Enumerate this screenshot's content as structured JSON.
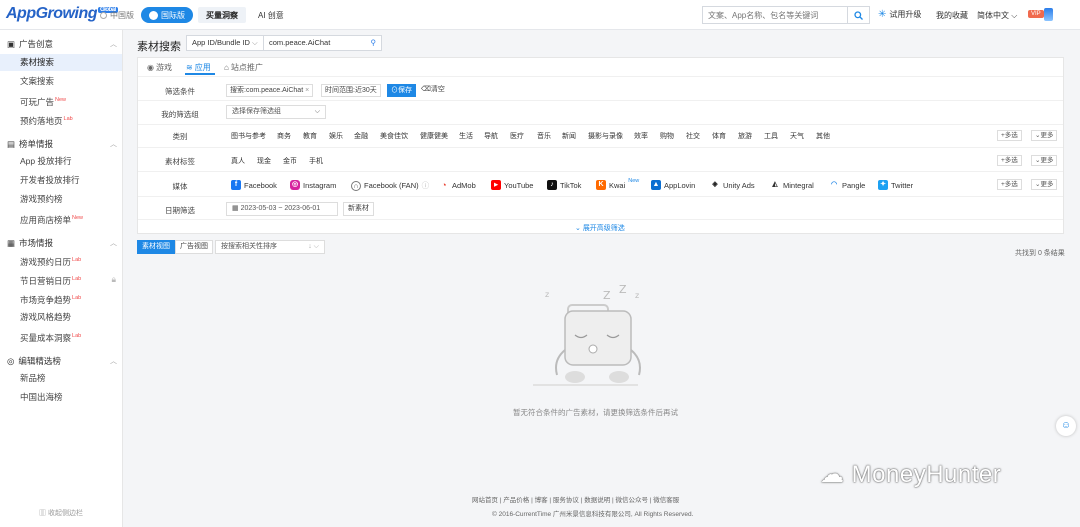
{
  "logo": {
    "text": "AppGrowing",
    "badge": "Global"
  },
  "nav": {
    "cn": "中国版",
    "intl": "国际版",
    "buy": "买量洞察",
    "ai": "AI 创意"
  },
  "search": {
    "placeholder": "文案、App名称、包名等关键词"
  },
  "header": {
    "upgrade": "试用升级",
    "fav": "我的收藏",
    "lang": "简体中文",
    "vip": "VIP"
  },
  "sidebar": {
    "sec1": "广告创意",
    "sec1_items": [
      {
        "label": "素材搜索",
        "badge": ""
      },
      {
        "label": "文案搜索",
        "badge": ""
      },
      {
        "label": "可玩广告",
        "badge": "New"
      },
      {
        "label": "预约落地页",
        "badge": "Lab"
      }
    ],
    "sec2": "榜单情报",
    "sec2_items": [
      {
        "label": "App 投放排行",
        "badge": ""
      },
      {
        "label": "开发者投放排行",
        "badge": ""
      },
      {
        "label": "游戏预约榜",
        "badge": ""
      },
      {
        "label": "应用商店榜单",
        "badge": "New"
      }
    ],
    "sec3": "市场情报",
    "sec3_items": [
      {
        "label": "游戏预约日历",
        "badge": "Lab"
      },
      {
        "label": "节日营销日历",
        "badge": "Lab"
      },
      {
        "label": "市场竞争趋势",
        "badge": "Lab"
      },
      {
        "label": "游戏风格趋势",
        "badge": ""
      },
      {
        "label": "买量成本洞察",
        "badge": "Lab"
      }
    ],
    "sec4": "编辑精选榜",
    "sec4_items": [
      {
        "label": "新品榜",
        "badge": ""
      },
      {
        "label": "中国出海榜",
        "badge": ""
      }
    ],
    "collapse": "收起侧边栏"
  },
  "main": {
    "title": "素材搜索",
    "id_type": "App ID/Bundle ID",
    "id_value": "com.peace.AiChat",
    "tabs": [
      "游戏",
      "应用",
      "站点推广"
    ],
    "labels": {
      "cond": "筛选条件",
      "mygroup": "我的筛选组",
      "cat": "类别",
      "tag": "素材标签",
      "media": "媒体",
      "date": "日期筛选"
    },
    "cond_tags": {
      "search": "搜索:com.peace.AiChat",
      "time": "时间范围:近30天",
      "save": "保存",
      "clear": "清空"
    },
    "group_placeholder": "选择保存筛选组",
    "categories": [
      "图书与参考",
      "商务",
      "教育",
      "娱乐",
      "金融",
      "美食佳饮",
      "健康健美",
      "生活",
      "导航",
      "医疗",
      "音乐",
      "新闻",
      "摄影与录像",
      "效率",
      "购物",
      "社交",
      "体育",
      "旅游",
      "工具",
      "天气",
      "其他"
    ],
    "tags": [
      "真人",
      "现金",
      "金币",
      "手机"
    ],
    "media": [
      {
        "name": "Facebook",
        "icon": "facebook-icon"
      },
      {
        "name": "Instagram",
        "icon": "instagram-icon"
      },
      {
        "name": "Facebook (FAN)",
        "icon": "facebook-fan-icon"
      },
      {
        "name": "AdMob",
        "icon": "admob-icon"
      },
      {
        "name": "YouTube",
        "icon": "youtube-icon"
      },
      {
        "name": "TikTok",
        "icon": "tiktok-icon"
      },
      {
        "name": "Kwai",
        "icon": "kwai-icon",
        "badge": "New"
      },
      {
        "name": "AppLovin",
        "icon": "applovin-icon"
      },
      {
        "name": "Unity Ads",
        "icon": "unity-icon"
      },
      {
        "name": "Mintegral",
        "icon": "mintegral-icon"
      },
      {
        "name": "Pangle",
        "icon": "pangle-icon"
      },
      {
        "name": "Twitter",
        "icon": "twitter-icon"
      }
    ],
    "multi": "多选",
    "more": "更多",
    "date_range": "2023-05-03 ~ 2023-06-01",
    "new_material": "新素材",
    "expand": "展开高级筛选",
    "view_tabs": [
      "素材视图",
      "广告视图"
    ],
    "sort": "按搜索相关性排序",
    "count": "共找到 0 条结果",
    "empty": "暂无符合条件的广告素材，请更换筛选条件后再试"
  },
  "footer": {
    "links": "网站首页 | 产品价格 | 博客 | 服务协议 | 数据说明 | 微信公众号 | 微信客服",
    "copyright": "© 2016-CurrentTime 广州米景信息科技有限公司, All Rights Reserved."
  },
  "watermark": "MoneyHunter",
  "colors": {
    "accent": "#1e88e5",
    "badge": "#f04a4a"
  }
}
